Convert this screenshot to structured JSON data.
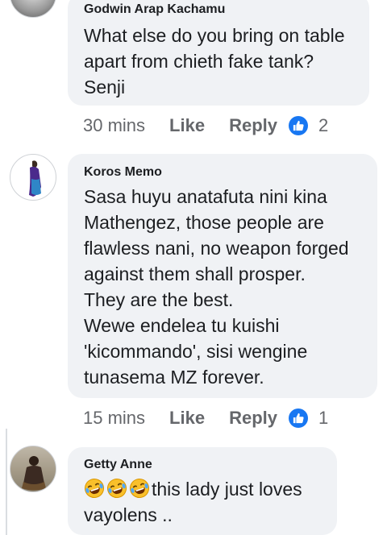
{
  "comments": [
    {
      "author": "Godwin Arap Kachamu",
      "lines": [
        "What else do you bring on table",
        "apart from chieth fake tank?",
        "Senji"
      ],
      "time": "30 mins",
      "like_label": "Like",
      "reply_label": "Reply",
      "reaction_count": "2"
    },
    {
      "author": "Koros Memo",
      "lines": [
        "Sasa huyu anatafuta nini kina",
        "Mathengez, those people are",
        "flawless nani, no weapon forged",
        "against them shall prosper.",
        "They are the best.",
        "Wewe endelea tu kuishi",
        "'kicommando', sisi wengine",
        "tunasema MZ forever."
      ],
      "time": "15 mins",
      "like_label": "Like",
      "reply_label": "Reply",
      "reaction_count": "1"
    },
    {
      "author": "Getty Anne",
      "emojis": [
        "face-with-tears-of-joy",
        "face-with-tears-of-joy",
        "face-with-tears-of-joy"
      ],
      "lines": [
        "this lady just loves",
        "vayolens .."
      ]
    }
  ],
  "icons": {
    "like_reaction": "thumbs-up-icon",
    "emoji": "laughing-face-emoji"
  },
  "colors": {
    "bubble": "#f0f2f5",
    "like_blue": "#1877f2",
    "meta_gray": "#65676b",
    "text": "#1c1e21"
  }
}
